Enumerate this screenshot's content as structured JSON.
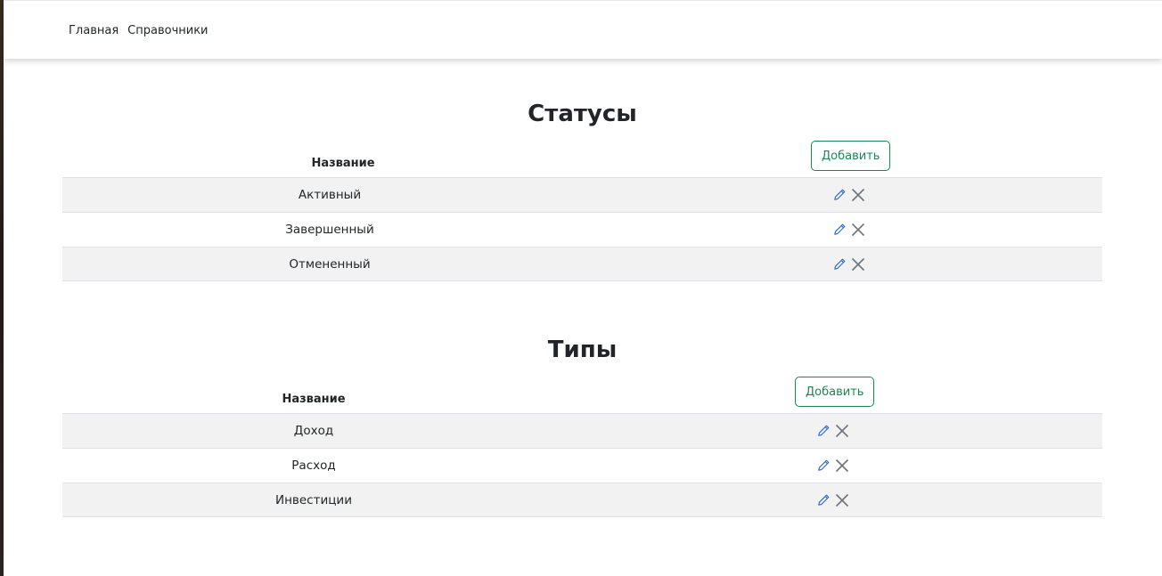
{
  "nav": {
    "home": "Главная",
    "references": "Справочники"
  },
  "statuses": {
    "title": "Статусы",
    "column_name": "Название",
    "add_label": "Добавить",
    "rows": [
      {
        "name": "Активный"
      },
      {
        "name": "Завершенный"
      },
      {
        "name": "Отмененный"
      }
    ]
  },
  "types": {
    "title": "Типы",
    "column_name": "Название",
    "add_label": "Добавить",
    "rows": [
      {
        "name": "Доход"
      },
      {
        "name": "Расход"
      },
      {
        "name": "Инвестиции"
      }
    ]
  },
  "colors": {
    "accent_green": "#198754",
    "edit_icon_blue": "#2f6fd6",
    "delete_icon_gray": "#6c757d",
    "row_shade": "#f2f2f2"
  },
  "icons": {
    "edit": "pencil-icon",
    "delete": "close-icon"
  }
}
